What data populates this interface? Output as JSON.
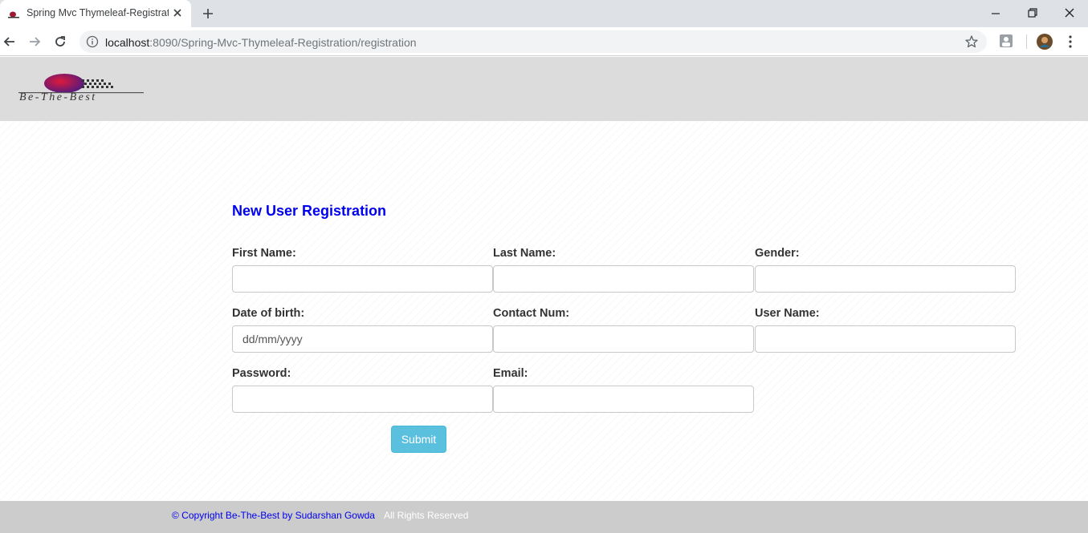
{
  "browser": {
    "tab_title": "Spring Mvc Thymeleaf-Registration",
    "url_host": "localhost",
    "url_rest": ":8090/Spring-Mvc-Thymeleaf-Registration/registration"
  },
  "header": {
    "logo_text": "Be-The-Best"
  },
  "form": {
    "title": "New User Registration",
    "fields": [
      {
        "label": "First Name:",
        "value": "",
        "placeholder": ""
      },
      {
        "label": "Last Name:",
        "value": "",
        "placeholder": ""
      },
      {
        "label": "Gender:",
        "value": "",
        "placeholder": ""
      },
      {
        "label": "Date of birth:",
        "value": "",
        "placeholder": "dd/mm/yyyy"
      },
      {
        "label": "Contact Num:",
        "value": "",
        "placeholder": ""
      },
      {
        "label": "User Name:",
        "value": "",
        "placeholder": ""
      },
      {
        "label": "Password:",
        "value": "",
        "placeholder": ""
      },
      {
        "label": "Email:",
        "value": "",
        "placeholder": ""
      }
    ],
    "submit_label": "Submit"
  },
  "footer": {
    "copyright": "© Copyright Be-The-Best by Sudarshan Gowda",
    "rights": "All Rights Reserved"
  },
  "colors": {
    "title": "#0000ee",
    "submit": "#5bc0de",
    "header_bg": "#dcdcdc",
    "footer_bg": "#cccccc"
  },
  "icons": [
    "favicon-icon",
    "close-icon",
    "plus-icon",
    "minimize-icon",
    "restore-icon",
    "window-close-icon",
    "back-arrow-icon",
    "forward-arrow-icon",
    "reload-icon",
    "info-icon",
    "star-icon",
    "extension-icon",
    "menu-dots-icon"
  ]
}
